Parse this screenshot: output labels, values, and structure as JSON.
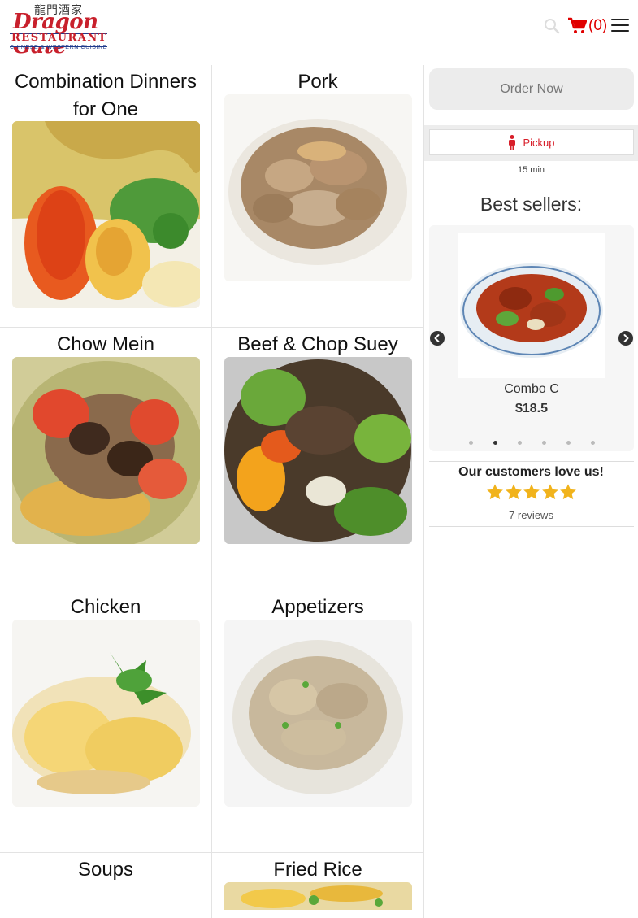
{
  "header": {
    "logo": {
      "chinese": "龍門酒家",
      "script": "Dragon Gate",
      "word": "RESTAURANT",
      "sub": "CHINESE & WESTERN CUISINE"
    },
    "cart_count": "(0)"
  },
  "categories": [
    {
      "title": "Combination Dinners for One",
      "photo": "combo-dinner"
    },
    {
      "title": "Pork",
      "photo": "pork"
    },
    {
      "title": "Chow Mein",
      "photo": "chow-mein"
    },
    {
      "title": "Beef & Chop Suey",
      "photo": "beef"
    },
    {
      "title": "Chicken",
      "photo": "chicken"
    },
    {
      "title": "Appetizers",
      "photo": "appetizers"
    },
    {
      "title": "Soups",
      "photo": "soups"
    },
    {
      "title": "Fried Rice",
      "photo": "fried-rice"
    }
  ],
  "sidebar": {
    "order_now": "Order Now",
    "pickup_label": "Pickup",
    "wait_time": "15 min",
    "best_sellers_title": "Best sellers:",
    "carousel": {
      "item_name": "Combo C",
      "item_price": "$18.5",
      "slide_count": 6,
      "active_slide": 2
    },
    "love_title": "Our customers love us!",
    "rating_stars": 5,
    "reviews": "7 reviews"
  },
  "colors": {
    "brand_red": "#c8202c",
    "cart_red": "#e00000",
    "star_gold": "#f1b31c"
  },
  "icons": [
    "search-icon",
    "cart-icon",
    "hamburger-menu-icon",
    "person-icon",
    "chevron-left-icon",
    "chevron-right-icon",
    "star-icon"
  ]
}
